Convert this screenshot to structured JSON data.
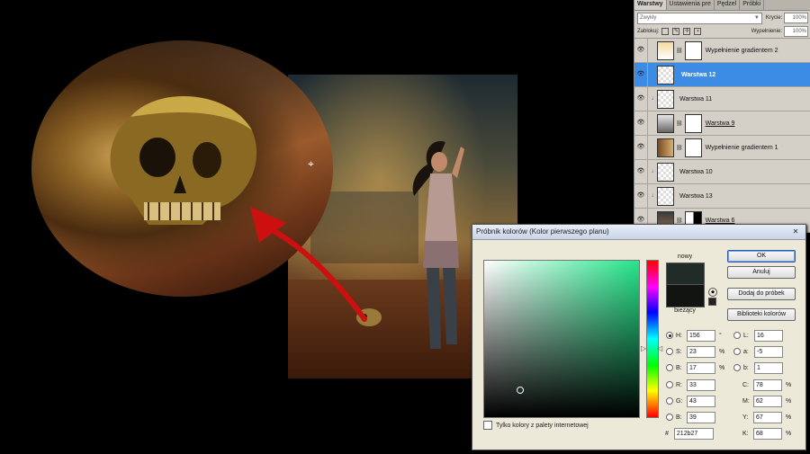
{
  "layers_panel": {
    "tabs": [
      "Warstwy",
      "Ustawienia pre",
      "Pędzel",
      "Próbki"
    ],
    "blend_mode": "Zwykły",
    "opacity_label": "Krycie:",
    "opacity_value": "100%",
    "lock_label": "Zablokuj:",
    "fill_label": "Wypełnienie:",
    "fill_value": "100%",
    "layers": [
      {
        "name": "Wypełnienie gradientem 2",
        "selected": false
      },
      {
        "name": "Warstwa 12",
        "selected": true
      },
      {
        "name": "Warstwa 11",
        "selected": false
      },
      {
        "name": "Warstwa 9",
        "selected": false
      },
      {
        "name": "Wypełnienie gradientem 1",
        "selected": false
      },
      {
        "name": "Warstwa 10",
        "selected": false
      },
      {
        "name": "Warstwa 13",
        "selected": false
      },
      {
        "name": "Warstwa 6",
        "selected": false
      }
    ]
  },
  "color_picker": {
    "title": "Próbnik kolorów (Kolor pierwszego planu)",
    "new_label": "nowy",
    "current_label": "bieżący",
    "new_color": "#212b27",
    "current_color": "#121412",
    "buttons": {
      "ok": "OK",
      "cancel": "Anuluj",
      "add_swatch": "Dodaj do próbek",
      "libraries": "Biblioteki kolorów"
    },
    "hsb": [
      {
        "label": "H:",
        "value": "156",
        "unit": "°",
        "selected": true
      },
      {
        "label": "S:",
        "value": "23",
        "unit": "%",
        "selected": false
      },
      {
        "label": "B:",
        "value": "17",
        "unit": "%",
        "selected": false
      }
    ],
    "rgb": [
      {
        "label": "R:",
        "value": "33"
      },
      {
        "label": "G:",
        "value": "43"
      },
      {
        "label": "B:",
        "value": "39"
      }
    ],
    "lab": [
      {
        "label": "L:",
        "value": "16"
      },
      {
        "label": "a:",
        "value": "-5"
      },
      {
        "label": "b:",
        "value": "1"
      }
    ],
    "cmyk": [
      {
        "label": "C:",
        "value": "78",
        "unit": "%"
      },
      {
        "label": "M:",
        "value": "62",
        "unit": "%"
      },
      {
        "label": "Y:",
        "value": "67",
        "unit": "%"
      },
      {
        "label": "K:",
        "value": "68",
        "unit": "%"
      }
    ],
    "hex_label": "#",
    "hex_value": "212b27",
    "web_only_label": "Tylko kolory z palety internetowej",
    "hue_color": "#25e58a"
  },
  "colors": {
    "selection_blue": "#3c8ce6",
    "dialog_bg": "#ece9d8",
    "panel_bg": "#d4d0c8",
    "arrow_red": "#cc1010"
  }
}
